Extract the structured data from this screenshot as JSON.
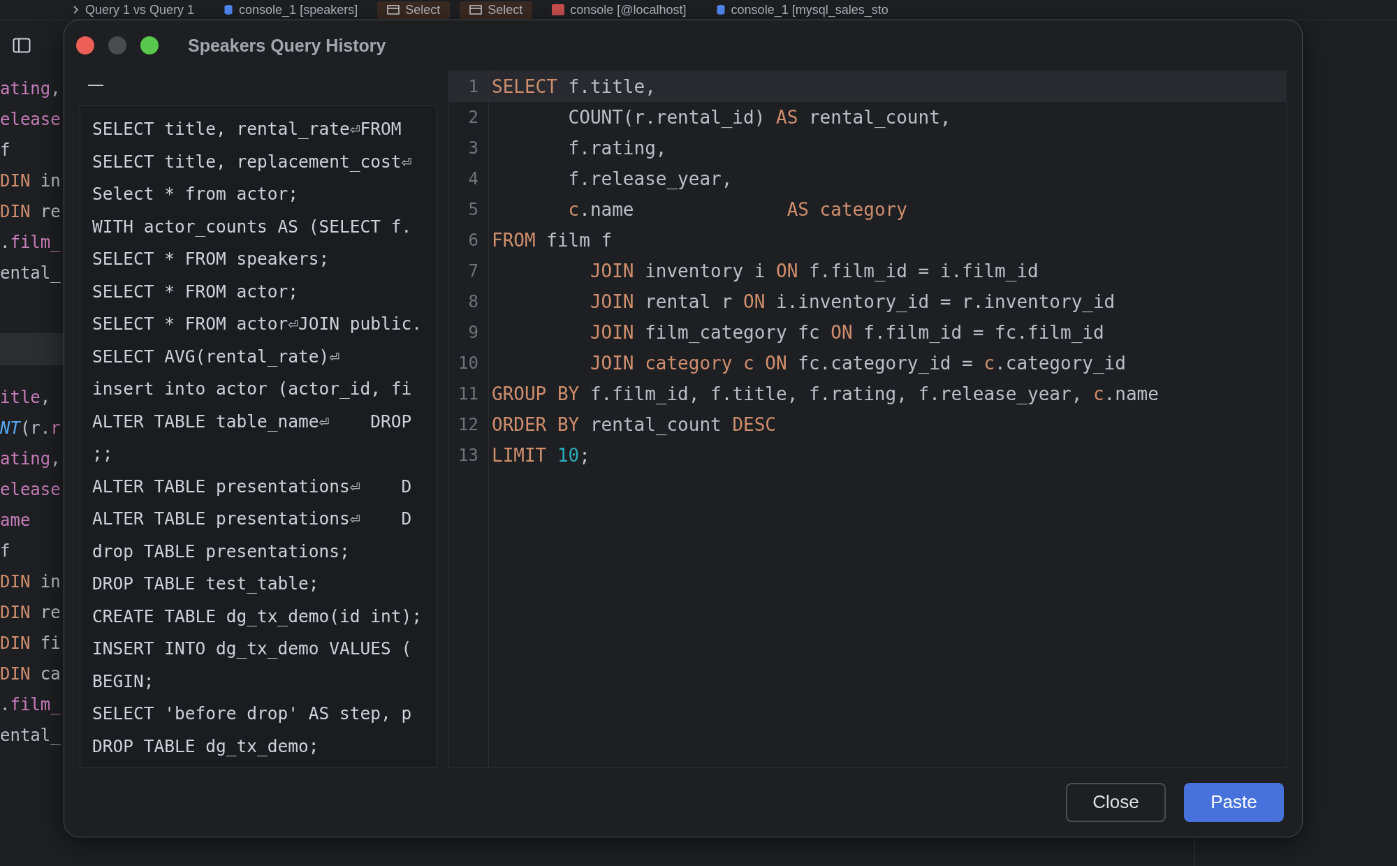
{
  "tabs": [
    {
      "kind": "chevron",
      "label": "Query 1 vs Query 1",
      "highlighted": false
    },
    {
      "kind": "database",
      "label": "console_1 [speakers]",
      "highlighted": false
    },
    {
      "kind": "table",
      "label": "Select",
      "highlighted": true
    },
    {
      "kind": "table",
      "label": "Select",
      "highlighted": true
    },
    {
      "kind": "console",
      "label": "console [@localhost]",
      "highlighted": false
    },
    {
      "kind": "database",
      "label": "console_1 [mysql_sales_sto",
      "highlighted": false
    }
  ],
  "background_editor": {
    "top_lines": [
      [
        {
          "kind": "field",
          "t": "ating"
        },
        {
          "kind": "plain",
          "t": ","
        }
      ],
      [
        {
          "kind": "field",
          "t": "elease"
        }
      ],
      [
        {
          "kind": "plain",
          "t": "f"
        }
      ],
      [
        {
          "kind": "kw",
          "t": "DIN"
        },
        {
          "kind": "plain",
          "t": " in"
        }
      ],
      [
        {
          "kind": "kw",
          "t": "DIN"
        },
        {
          "kind": "plain",
          "t": " re"
        }
      ],
      [
        {
          "kind": "plain",
          "t": "."
        },
        {
          "kind": "field",
          "t": "film_"
        }
      ],
      [
        {
          "kind": "plain",
          "t": "ental_"
        }
      ]
    ],
    "bottom_lines": [
      [
        {
          "kind": "field",
          "t": "itle"
        },
        {
          "kind": "plain",
          "t": ","
        }
      ],
      [
        {
          "kind": "fn",
          "t": "NT"
        },
        {
          "kind": "plain",
          "t": "(r."
        },
        {
          "kind": "field",
          "t": "r"
        }
      ],
      [
        {
          "kind": "field",
          "t": "ating"
        },
        {
          "kind": "plain",
          "t": ","
        }
      ],
      [
        {
          "kind": "field",
          "t": "elease"
        }
      ],
      [
        {
          "kind": "field",
          "t": "ame"
        }
      ],
      [
        {
          "kind": "plain",
          "t": "f"
        }
      ],
      [
        {
          "kind": "kw",
          "t": "DIN"
        },
        {
          "kind": "plain",
          "t": " in"
        }
      ],
      [
        {
          "kind": "kw",
          "t": "DIN"
        },
        {
          "kind": "plain",
          "t": " re"
        }
      ],
      [
        {
          "kind": "kw",
          "t": "DIN"
        },
        {
          "kind": "plain",
          "t": " fi"
        }
      ],
      [
        {
          "kind": "kw",
          "t": "DIN"
        },
        {
          "kind": "plain",
          "t": " ca"
        }
      ],
      [
        {
          "kind": "plain",
          "t": "."
        },
        {
          "kind": "field",
          "t": "film_"
        }
      ],
      [
        {
          "kind": "plain",
          "t": "ental_"
        }
      ]
    ]
  },
  "dialog": {
    "title": "Speakers Query History",
    "filter": "—",
    "history": [
      {
        "text": "SELECT title, rental_rate⏎FROM",
        "selected": false
      },
      {
        "text": "SELECT title, replacement_cost⏎",
        "selected": false
      },
      {
        "text": "Select * from actor;",
        "selected": false
      },
      {
        "text": "WITH actor_counts AS (SELECT f.",
        "selected": false
      },
      {
        "text": "SELECT * FROM speakers;",
        "selected": false
      },
      {
        "text": "SELECT * FROM actor;",
        "selected": false
      },
      {
        "text": "SELECT * FROM actor⏎JOIN public.",
        "selected": false
      },
      {
        "text": "SELECT AVG(rental_rate)⏎",
        "selected": false
      },
      {
        "text": "insert into actor (actor_id, fi",
        "selected": false
      },
      {
        "text": "ALTER TABLE table_name⏎    DROP",
        "selected": false
      },
      {
        "text": ";;",
        "selected": false
      },
      {
        "text": "ALTER TABLE presentations⏎    D",
        "selected": false
      },
      {
        "text": "ALTER TABLE presentations⏎    D",
        "selected": false
      },
      {
        "text": "drop TABLE presentations;",
        "selected": false
      },
      {
        "text": "DROP TABLE test_table;",
        "selected": false
      },
      {
        "text": "CREATE TABLE dg_tx_demo(id int);",
        "selected": false
      },
      {
        "text": "INSERT INTO dg_tx_demo VALUES (",
        "selected": false
      },
      {
        "text": "BEGIN;",
        "selected": false
      },
      {
        "text": "SELECT 'before drop' AS step, p",
        "selected": false
      },
      {
        "text": "DROP TABLE dg_tx_demo;",
        "selected": false
      }
    ],
    "code": [
      {
        "number": "1",
        "current": true,
        "segments": [
          {
            "kind": "kw",
            "t": "SELECT"
          },
          {
            "kind": "plain",
            "t": " f.title,"
          }
        ]
      },
      {
        "number": "2",
        "current": false,
        "segments": [
          {
            "kind": "plain",
            "t": "       COUNT(r.rental_id)"
          },
          {
            "kind": "kw",
            "t": " AS"
          },
          {
            "kind": "plain",
            "t": " rental_count,"
          }
        ]
      },
      {
        "number": "3",
        "current": false,
        "segments": [
          {
            "kind": "plain",
            "t": "       f.rating,"
          }
        ]
      },
      {
        "number": "4",
        "current": false,
        "segments": [
          {
            "kind": "plain",
            "t": "       f.release_year,"
          }
        ]
      },
      {
        "number": "5",
        "current": false,
        "segments": [
          {
            "kind": "alias",
            "t": "       c"
          },
          {
            "kind": "plain",
            "t": ".name"
          },
          {
            "kind": "kw",
            "t": "              AS"
          },
          {
            "kind": "alias",
            "t": " category"
          }
        ]
      },
      {
        "number": "6",
        "current": false,
        "segments": [
          {
            "kind": "kw",
            "t": "FROM"
          },
          {
            "kind": "plain",
            "t": " film f"
          }
        ]
      },
      {
        "number": "7",
        "current": false,
        "segments": [
          {
            "kind": "kw",
            "t": "         JOIN"
          },
          {
            "kind": "plain",
            "t": " inventory i"
          },
          {
            "kind": "kw",
            "t": " ON"
          },
          {
            "kind": "plain",
            "t": " f.film_id = i.film_id"
          }
        ]
      },
      {
        "number": "8",
        "current": false,
        "segments": [
          {
            "kind": "kw",
            "t": "         JOIN"
          },
          {
            "kind": "plain",
            "t": " rental r"
          },
          {
            "kind": "kw",
            "t": " ON"
          },
          {
            "kind": "plain",
            "t": " i.inventory_id = r.inventory_id"
          }
        ]
      },
      {
        "number": "9",
        "current": false,
        "segments": [
          {
            "kind": "kw",
            "t": "         JOIN"
          },
          {
            "kind": "plain",
            "t": " film_category fc"
          },
          {
            "kind": "kw",
            "t": " ON"
          },
          {
            "kind": "plain",
            "t": " f.film_id = fc.film_id"
          }
        ]
      },
      {
        "number": "10",
        "current": false,
        "segments": [
          {
            "kind": "kw",
            "t": "         JOIN"
          },
          {
            "kind": "alias",
            "t": " category c"
          },
          {
            "kind": "kw",
            "t": " ON"
          },
          {
            "kind": "plain",
            "t": " fc.category_id ="
          },
          {
            "kind": "alias",
            "t": " c"
          },
          {
            "kind": "plain",
            "t": ".category_id"
          }
        ]
      },
      {
        "number": "11",
        "current": false,
        "segments": [
          {
            "kind": "kw",
            "t": "GROUP BY"
          },
          {
            "kind": "plain",
            "t": " f.film_id, f.title, f.rating, f.release_year,"
          },
          {
            "kind": "alias",
            "t": " c"
          },
          {
            "kind": "plain",
            "t": ".name"
          }
        ]
      },
      {
        "number": "12",
        "current": false,
        "segments": [
          {
            "kind": "kw",
            "t": "ORDER BY"
          },
          {
            "kind": "plain",
            "t": " rental_count"
          },
          {
            "kind": "kw",
            "t": " DESC"
          }
        ]
      },
      {
        "number": "13",
        "current": false,
        "segments": [
          {
            "kind": "kw",
            "t": "LIMIT"
          },
          {
            "kind": "num",
            "t": " 10"
          },
          {
            "kind": "plain",
            "t": ";"
          }
        ]
      }
    ],
    "buttons": [
      {
        "label": "Close",
        "kind": "secondary"
      },
      {
        "label": "Paste",
        "kind": "primary"
      }
    ]
  }
}
